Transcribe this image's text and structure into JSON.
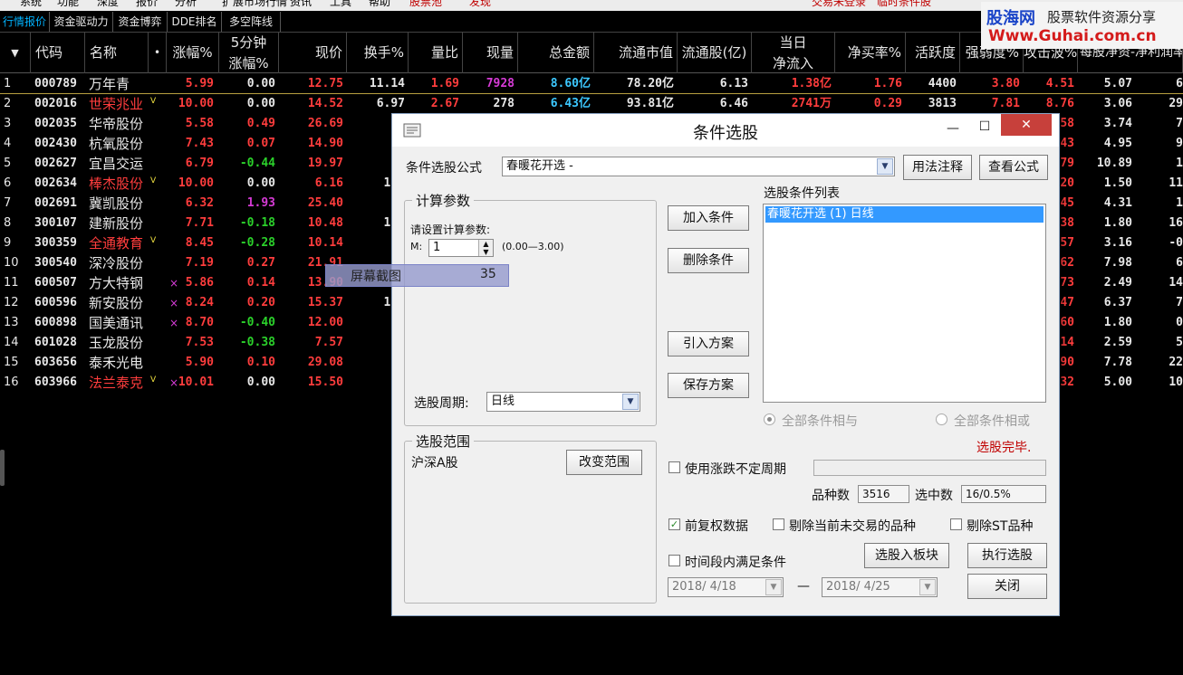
{
  "menu": [
    "系统",
    "功能",
    "深度",
    "报价",
    "分析",
    "扩展市场行情",
    "资讯",
    "工具",
    "帮助",
    "股票池",
    "发现",
    "交易未登录",
    "临时条件股"
  ],
  "tabs": [
    "行情报价",
    "资金驱动力",
    "资金博弈",
    "DDE排名",
    "多空阵线"
  ],
  "columns": {
    "arrow": "▼",
    "code": "代码",
    "name": "名称",
    "dot": "•",
    "chg": "涨幅%",
    "m5_1": "5分钟",
    "m5_2": "涨幅%",
    "price": "现价",
    "turnover": "换手%",
    "volratio": "量比",
    "curvol": "现量",
    "amount": "总金额",
    "mcap": "流通市值",
    "float": "流通股(亿)",
    "in1": "当日",
    "in2": "净流入",
    "netbuy": "净买率%",
    "activity": "活跃度",
    "strength": "强弱度%",
    "rise": "攻击波%",
    "per": "每股净资-净利润率"
  },
  "rows": [
    {
      "n": "1",
      "code": "000789",
      "name": "万年青",
      "v": "",
      "x": "",
      "chg": "5.99",
      "m5": "0.00",
      "price": "12.75",
      "turn": "11.14",
      "vr": "1.69",
      "cv": "7928",
      "amt": "8.60亿",
      "mcap": "78.20亿",
      "fs": "6.13",
      "inflow": "1.38亿",
      "nb": "1.76",
      "act": "4400",
      "str": "3.80",
      "rise": "4.51",
      "nav": "5.07",
      "last": "6"
    },
    {
      "n": "2",
      "code": "002016",
      "name": "世荣兆业",
      "v": "V",
      "x": "",
      "chg": "10.00",
      "m5": "0.00",
      "price": "14.52",
      "turn": "6.97",
      "vr": "2.67",
      "cv": "278",
      "amt": "6.43亿",
      "mcap": "93.81亿",
      "fs": "6.46",
      "inflow": "2741万",
      "nb": "0.29",
      "act": "3813",
      "str": "7.81",
      "rise": "8.76",
      "nav": "3.06",
      "last": "29"
    },
    {
      "n": "3",
      "code": "002035",
      "name": "华帝股份",
      "v": "",
      "x": "",
      "chg": "5.58",
      "m5": "0.49",
      "price": "26.69",
      "turn": "1.",
      "vr": "",
      "cv": "",
      "amt": "",
      "mcap": "",
      "fs": "",
      "inflow": "",
      "nb": "",
      "act": "",
      "str": "",
      "rise": ".58",
      "nav": "3.74",
      "last": "7"
    },
    {
      "n": "4",
      "code": "002430",
      "name": "杭氧股份",
      "v": "",
      "x": "",
      "chg": "7.43",
      "m5": "0.07",
      "price": "14.90",
      "turn": "1.",
      "vr": "",
      "cv": "",
      "amt": "",
      "mcap": "",
      "fs": "",
      "inflow": "",
      "nb": "",
      "act": "",
      "str": "",
      "rise": ".43",
      "nav": "4.95",
      "last": "9"
    },
    {
      "n": "5",
      "code": "002627",
      "name": "宜昌交运",
      "v": "",
      "x": "",
      "chg": "6.79",
      "m5": "-0.44",
      "price": "19.97",
      "turn": "5.",
      "vr": "",
      "cv": "",
      "amt": "",
      "mcap": "",
      "fs": "",
      "inflow": "",
      "nb": "",
      "act": "",
      "str": "",
      "rise": ".79",
      "nav": "10.89",
      "last": "1"
    },
    {
      "n": "6",
      "code": "002634",
      "name": "棒杰股份",
      "v": "V",
      "x": "",
      "chg": "10.00",
      "m5": "0.00",
      "price": "6.16",
      "turn": "12.",
      "vr": "",
      "cv": "",
      "amt": "",
      "mcap": "",
      "fs": "",
      "inflow": "",
      "nb": "",
      "act": "",
      "str": "",
      "rise": ".20",
      "nav": "1.50",
      "last": "11"
    },
    {
      "n": "7",
      "code": "002691",
      "name": "冀凯股份",
      "v": "",
      "x": "",
      "chg": "6.32",
      "m5": "1.93",
      "price": "25.40",
      "turn": "3.",
      "vr": "",
      "cv": "",
      "amt": "",
      "mcap": "",
      "fs": "",
      "inflow": "",
      "nb": "",
      "act": "",
      "str": "",
      "rise": ".45",
      "nav": "4.31",
      "last": "1"
    },
    {
      "n": "8",
      "code": "300107",
      "name": "建新股份",
      "v": "",
      "x": "",
      "chg": "7.71",
      "m5": "-0.18",
      "price": "10.48",
      "turn": "14.",
      "vr": "",
      "cv": "",
      "amt": "",
      "mcap": "",
      "fs": "",
      "inflow": "",
      "nb": "",
      "act": "",
      "str": "",
      "rise": ".38",
      "nav": "1.80",
      "last": "16"
    },
    {
      "n": "9",
      "code": "300359",
      "name": "全通教育",
      "v": "V",
      "x": "",
      "chg": "8.45",
      "m5": "-0.28",
      "price": "10.14",
      "turn": "9.",
      "vr": "",
      "cv": "",
      "amt": "",
      "mcap": "",
      "fs": "",
      "inflow": "",
      "nb": "",
      "act": "",
      "str": "",
      "rise": ".57",
      "nav": "3.16",
      "last": "-0"
    },
    {
      "n": "10",
      "code": "300540",
      "name": "深冷股份",
      "v": "",
      "x": "",
      "chg": "7.19",
      "m5": "0.27",
      "price": "21.91",
      "turn": "2.",
      "vr": "",
      "cv": "",
      "amt": "",
      "mcap": "",
      "fs": "",
      "inflow": "",
      "nb": "",
      "act": "",
      "str": "",
      "rise": ".62",
      "nav": "7.98",
      "last": "6"
    },
    {
      "n": "11",
      "code": "600507",
      "name": "方大特钢",
      "v": "",
      "x": "×",
      "chg": "5.86",
      "m5": "0.14",
      "price": "13.90",
      "turn": "3.",
      "vr": "",
      "cv": "",
      "amt": "",
      "mcap": "",
      "fs": "",
      "inflow": "",
      "nb": "",
      "act": "",
      "str": "",
      "rise": ".73",
      "nav": "2.49",
      "last": "14"
    },
    {
      "n": "12",
      "code": "600596",
      "name": "新安股份",
      "v": "",
      "x": "×",
      "chg": "8.24",
      "m5": "0.20",
      "price": "15.37",
      "turn": "11.",
      "vr": "",
      "cv": "",
      "amt": "",
      "mcap": "",
      "fs": "",
      "inflow": "",
      "nb": "",
      "act": "",
      "str": "",
      "rise": ".47",
      "nav": "6.37",
      "last": "7"
    },
    {
      "n": "13",
      "code": "600898",
      "name": "国美通讯",
      "v": "",
      "x": "×",
      "chg": "8.70",
      "m5": "-0.40",
      "price": "12.00",
      "turn": "1.",
      "vr": "",
      "cv": "",
      "amt": "",
      "mcap": "",
      "fs": "",
      "inflow": "",
      "nb": "",
      "act": "",
      "str": "",
      "rise": ".60",
      "nav": "1.80",
      "last": "0"
    },
    {
      "n": "14",
      "code": "601028",
      "name": "玉龙股份",
      "v": "",
      "x": "",
      "chg": "7.53",
      "m5": "-0.38",
      "price": "7.57",
      "turn": "0.",
      "vr": "",
      "cv": "",
      "amt": "",
      "mcap": "",
      "fs": "",
      "inflow": "",
      "nb": "",
      "act": "",
      "str": "",
      "rise": ".14",
      "nav": "2.59",
      "last": "5"
    },
    {
      "n": "15",
      "code": "603656",
      "name": "泰禾光电",
      "v": "",
      "x": "",
      "chg": "5.90",
      "m5": "0.10",
      "price": "29.08",
      "turn": "2.",
      "vr": "",
      "cv": "",
      "amt": "",
      "mcap": "",
      "fs": "",
      "inflow": "",
      "nb": "",
      "act": "",
      "str": "",
      "rise": ".90",
      "nav": "7.78",
      "last": "22"
    },
    {
      "n": "16",
      "code": "603966",
      "name": "法兰泰克",
      "v": "V",
      "x": "×",
      "chg": "10.01",
      "m5": "0.00",
      "price": "15.50",
      "turn": "5.",
      "vr": "",
      "cv": "",
      "amt": "",
      "mcap": "",
      "fs": "",
      "inflow": "",
      "nb": "",
      "act": "",
      "str": "",
      "rise": ".32",
      "nav": "5.00",
      "last": "10"
    }
  ],
  "watermark": {
    "line1a": "股海网",
    "line1b": "股票软件资源分享",
    "line2": "Www.Guhai.com.cn"
  },
  "screenshot": {
    "label": "屏幕截图",
    "value": "35"
  },
  "dialog": {
    "title": "条件选股",
    "min": "—",
    "max": "☐",
    "close": "✕",
    "formula_label": "条件选股公式",
    "formula_value": "春暖花开选   -",
    "usage_btn": "用法注释",
    "view_btn": "查看公式",
    "params_group": "计算参数",
    "params_hint": "请设置计算参数:",
    "param_name": "M:",
    "param_value": "1",
    "param_range": "(0.00—3.00)",
    "period_label": "选股周期:",
    "period_value": "日线",
    "add_btn": "加入条件",
    "del_btn": "删除条件",
    "import_btn": "引入方案",
    "save_btn": "保存方案",
    "list_label": "选股条件列表",
    "list_items": [
      "春暖花开选  (1)  日线"
    ],
    "and_label": "全部条件相与",
    "or_label": "全部条件相或",
    "status": "选股完毕.",
    "range_group": "选股范围",
    "range_value": "沪深A股",
    "range_btn": "改变范围",
    "float_period": "使用涨跌不定周期",
    "count_label": "品种数",
    "count_value": "3516",
    "selected_label": "选中数",
    "selected_value": "16/0.5%",
    "adj_label": "前复权数据",
    "excl_label": "剔除当前未交易的品种",
    "st_label": "剔除ST品种",
    "time_label": "时间段内满足条件",
    "to_block_btn": "选股入板块",
    "run_btn": "执行选股",
    "date_from": "2018/ 4/18",
    "date_to": "2018/ 4/25",
    "dash": "—",
    "close_btn": "关闭",
    "check_mark": "✓",
    "dd_arrow": "▼"
  },
  "colors": {
    "up": "#ff3d3d",
    "down": "#2bd12b",
    "flat": "#e8e8e8",
    "cyan": "#3cc8ff",
    "magenta": "#d63bd6",
    "yellow": "#f0e040",
    "white": "#e8e8e8"
  }
}
